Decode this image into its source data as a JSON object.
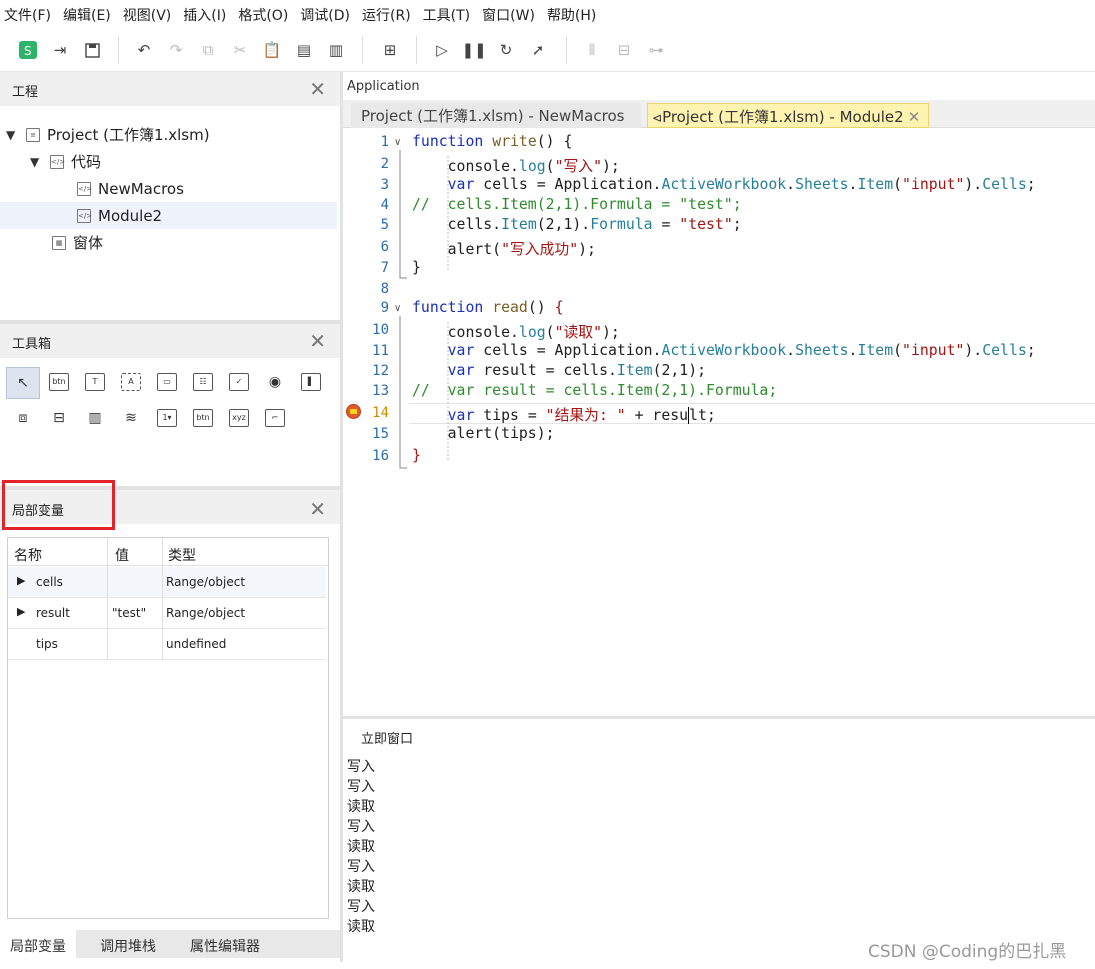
{
  "menubar": [
    "文件(F)",
    "编辑(E)",
    "视图(V)",
    "插入(I)",
    "格式(O)",
    "调试(D)",
    "运行(R)",
    "工具(T)",
    "窗口(W)",
    "帮助(H)"
  ],
  "project_panel": {
    "title": "工程",
    "items": [
      {
        "label": "Project (工作簿1.xlsm)"
      },
      {
        "label": "代码"
      },
      {
        "label": "NewMacros"
      },
      {
        "label": "Module2"
      },
      {
        "label": "窗体"
      }
    ]
  },
  "toolbox_panel": {
    "title": "工具箱"
  },
  "locals_panel": {
    "title": "局部变量",
    "columns": [
      "名称",
      "值",
      "类型"
    ],
    "rows": [
      {
        "name": "cells",
        "value": "",
        "type": "Range/object"
      },
      {
        "name": "result",
        "value": "\"test\"",
        "type": "Range/object"
      },
      {
        "name": "tips",
        "value": "",
        "type": "undefined"
      }
    ]
  },
  "bottom_tabs": [
    "局部变量",
    "调用堆栈",
    "属性编辑器"
  ],
  "editor": {
    "header": "Application",
    "tabs": [
      "Project (工作簿1.xlsm) - NewMacros",
      "Project (工作簿1.xlsm) - Module2"
    ],
    "current_line": 14
  },
  "immediate": {
    "title": "立即窗口",
    "lines": [
      "写入",
      "写入",
      "读取",
      "写入",
      "读取",
      "写入",
      "读取",
      "写入",
      "读取"
    ]
  },
  "watermark": "CSDN @Coding的巴扎黑"
}
